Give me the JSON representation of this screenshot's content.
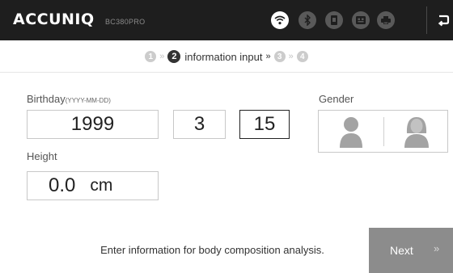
{
  "header": {
    "logo": "ACCUNIQ",
    "model": "BC380PRO",
    "icons": [
      "wifi-icon",
      "bluetooth-icon",
      "card-icon",
      "barcode-icon",
      "printer-icon"
    ],
    "active_icon": "wifi-icon"
  },
  "steps": {
    "step1": "1",
    "step2": "2",
    "current_label": "information input",
    "step3": "3",
    "step4": "4"
  },
  "form": {
    "birthday_label": "Birthday",
    "birthday_format": "(YYYY-MM-DD)",
    "year": "1999",
    "month": "3",
    "day": "15",
    "height_label": "Height",
    "height_value": "0.0",
    "height_unit": "cm",
    "gender_label": "Gender"
  },
  "footer": {
    "hint": "Enter information for body composition analysis.",
    "next_label": "Next",
    "next_chevron": "»"
  },
  "colors": {
    "header_bg": "#1e1e1e",
    "inactive_icon": "#595959",
    "button_bg": "#8c8c8c"
  }
}
